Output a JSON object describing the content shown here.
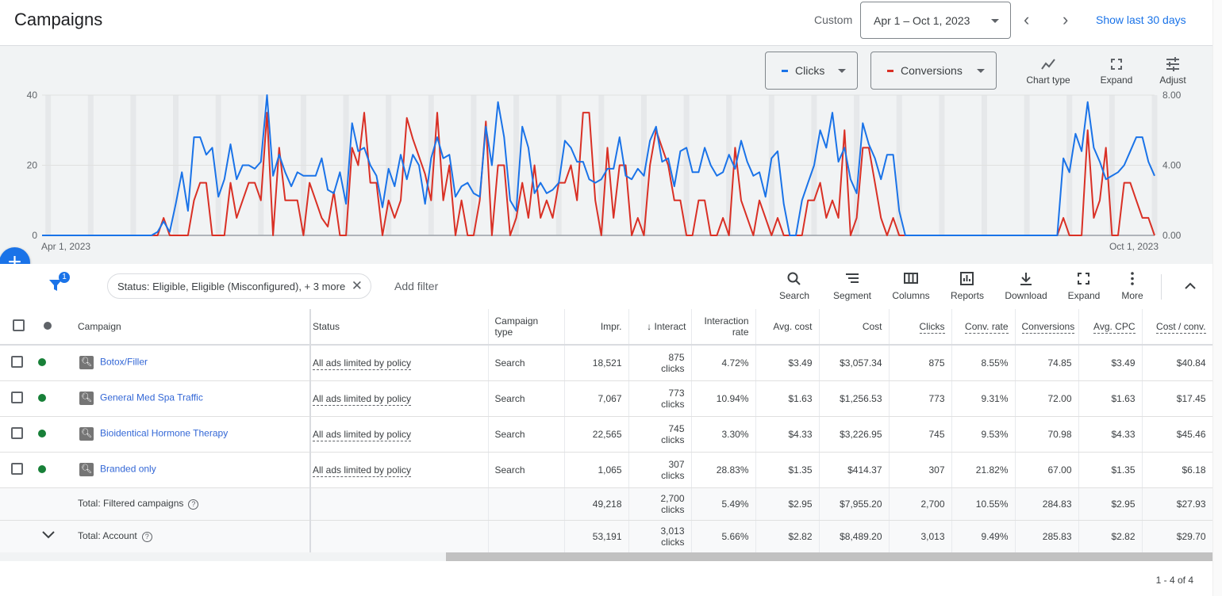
{
  "header": {
    "title": "Campaigns",
    "range_type": "Custom",
    "date_range": "Apr 1 – Oct 1, 2023",
    "show_last": "Show last 30 days"
  },
  "chart_controls": {
    "metric1": "Clicks",
    "metric2": "Conversions",
    "metric1_color": "#1a73e8",
    "metric2_color": "#d93025",
    "chart_type": "Chart type",
    "expand": "Expand",
    "adjust": "Adjust"
  },
  "chart_data": {
    "type": "line",
    "x_start": "Apr 1, 2023",
    "x_end": "Oct 1, 2023",
    "x_tick_labels": [
      "Apr 1, 2023",
      "Oct 1, 2023"
    ],
    "left_axis": {
      "ticks": [
        "0",
        "20",
        "40"
      ],
      "ylim": [
        0,
        40
      ]
    },
    "right_axis": {
      "ticks": [
        "0.00",
        "4.00",
        "8.00"
      ],
      "ylim": [
        0,
        8
      ]
    },
    "grid": true,
    "series": [
      {
        "name": "Clicks",
        "axis": "left",
        "color": "#1a73e8",
        "values": [
          0,
          0,
          0,
          0,
          0,
          0,
          0,
          0,
          0,
          0,
          0,
          0,
          0,
          0,
          0,
          0,
          0,
          0,
          0,
          1,
          4,
          1,
          9,
          18,
          7,
          28,
          28,
          23,
          25,
          11,
          16,
          26,
          16,
          20,
          20,
          19,
          21,
          40,
          17,
          23,
          18,
          14,
          18,
          17,
          17,
          17,
          22,
          13,
          12,
          18,
          9,
          32,
          24,
          25,
          20,
          17,
          8,
          19,
          14,
          23,
          16,
          23,
          20,
          9,
          22,
          28,
          22,
          23,
          11,
          14,
          15,
          12,
          11,
          31,
          20,
          38,
          28,
          10,
          7,
          31,
          25,
          12,
          15,
          12,
          13,
          15,
          27,
          25,
          21,
          21,
          16,
          15,
          16,
          19,
          19,
          28,
          17,
          16,
          19,
          17,
          27,
          31,
          21,
          22,
          14,
          24,
          25,
          18,
          18,
          25,
          20,
          17,
          18,
          23,
          19,
          27,
          21,
          17,
          18,
          11,
          22,
          24,
          9,
          0,
          0,
          10,
          15,
          20,
          30,
          25,
          35,
          21,
          25,
          16,
          12,
          32,
          26,
          22,
          16,
          23,
          23,
          7,
          0,
          0,
          0,
          0,
          0,
          0,
          0,
          0,
          0,
          0,
          0,
          0,
          0,
          0,
          0,
          0,
          0,
          0,
          0,
          0,
          0,
          0,
          0,
          0,
          0,
          0,
          22,
          18,
          29,
          24,
          38,
          25,
          21,
          16,
          17,
          18,
          20,
          24,
          28,
          28,
          21,
          17
        ]
      },
      {
        "name": "Conversions",
        "axis": "right",
        "color": "#d93025",
        "values": [
          0,
          0,
          0,
          0,
          0,
          0,
          0,
          0,
          0,
          0,
          0,
          0,
          0,
          0,
          0,
          0,
          0,
          0,
          0,
          0,
          1,
          0,
          0,
          0,
          0,
          2,
          3,
          3,
          0,
          0,
          0,
          3,
          1,
          2,
          3,
          3,
          2,
          7,
          0,
          5,
          2,
          2,
          2,
          0,
          3,
          2,
          1,
          0.5,
          2.5,
          0,
          0,
          5,
          4,
          7,
          3,
          3,
          0,
          2,
          1,
          2,
          6.7,
          5.5,
          4.5,
          3.5,
          2,
          7,
          2,
          4,
          0,
          2,
          0,
          0,
          2,
          6.5,
          0,
          4,
          4,
          0,
          1,
          3,
          1,
          4,
          1,
          2,
          1,
          3,
          3,
          4,
          2,
          7,
          7,
          2,
          0,
          5,
          1,
          4,
          4,
          0,
          1,
          0,
          4,
          6,
          5,
          4,
          2,
          2,
          0,
          0,
          2,
          2,
          0,
          0,
          1,
          0,
          5,
          2,
          1,
          0,
          2,
          1,
          0,
          1,
          0,
          0,
          0,
          0,
          2,
          2,
          3,
          1,
          2,
          1,
          6,
          0,
          1,
          5,
          5,
          3,
          1,
          0,
          1,
          0,
          0,
          0,
          0,
          0,
          0,
          0,
          0,
          0,
          0,
          0,
          0,
          0,
          0,
          0,
          0,
          0,
          0,
          0,
          0,
          0,
          0,
          0,
          0,
          0,
          0,
          0,
          1,
          0,
          0,
          0,
          6,
          1,
          2,
          5,
          0,
          0,
          3,
          3,
          2,
          1,
          1,
          0
        ]
      }
    ]
  },
  "filters": {
    "count": "1",
    "chip": "Status: Eligible, Eligible (Misconfigured), + 3 more",
    "add": "Add filter"
  },
  "toolbar": [
    "Search",
    "Segment",
    "Columns",
    "Reports",
    "Download",
    "Expand",
    "More"
  ],
  "table": {
    "columns": [
      "Campaign",
      "Status",
      "Campaign type",
      "Impr.",
      "Interact",
      "Interaction rate",
      "Avg. cost",
      "Cost",
      "Clicks",
      "Conv. rate",
      "Conversions",
      "Avg. CPC",
      "Cost / conv."
    ],
    "rows": [
      {
        "campaign": "Botox/Filler",
        "status": "All ads limited by policy",
        "type": "Search",
        "impr": "18,521",
        "inter": "875",
        "inter_unit": "clicks",
        "rate": "4.72%",
        "avg_cost": "$3.49",
        "cost": "$3,057.34",
        "clicks": "875",
        "conv_rate": "8.55%",
        "conv": "74.85",
        "cpc": "$3.49",
        "cpconv": "$40.84"
      },
      {
        "campaign": "General Med Spa Traffic",
        "status": "All ads limited by policy",
        "type": "Search",
        "impr": "7,067",
        "inter": "773",
        "inter_unit": "clicks",
        "rate": "10.94%",
        "avg_cost": "$1.63",
        "cost": "$1,256.53",
        "clicks": "773",
        "conv_rate": "9.31%",
        "conv": "72.00",
        "cpc": "$1.63",
        "cpconv": "$17.45"
      },
      {
        "campaign": "Bioidentical Hormone Therapy",
        "status": "All ads limited by policy",
        "type": "Search",
        "impr": "22,565",
        "inter": "745",
        "inter_unit": "clicks",
        "rate": "3.30%",
        "avg_cost": "$4.33",
        "cost": "$3,226.95",
        "clicks": "745",
        "conv_rate": "9.53%",
        "conv": "70.98",
        "cpc": "$4.33",
        "cpconv": "$45.46"
      },
      {
        "campaign": "Branded only",
        "status": "All ads limited by policy",
        "type": "Search",
        "impr": "1,065",
        "inter": "307",
        "inter_unit": "clicks",
        "rate": "28.83%",
        "avg_cost": "$1.35",
        "cost": "$414.37",
        "clicks": "307",
        "conv_rate": "21.82%",
        "conv": "67.00",
        "cpc": "$1.35",
        "cpconv": "$6.18"
      }
    ],
    "totals": [
      {
        "label": "Total: Filtered campaigns",
        "impr": "49,218",
        "inter": "2,700",
        "inter_unit": "clicks",
        "rate": "5.49%",
        "avg_cost": "$2.95",
        "cost": "$7,955.20",
        "clicks": "2,700",
        "conv_rate": "10.55%",
        "conv": "284.83",
        "cpc": "$2.95",
        "cpconv": "$27.93"
      },
      {
        "label": "Total: Account",
        "impr": "53,191",
        "inter": "3,013",
        "inter_unit": "clicks",
        "rate": "5.66%",
        "avg_cost": "$2.82",
        "cost": "$8,489.20",
        "clicks": "3,013",
        "conv_rate": "9.49%",
        "conv": "285.83",
        "cpc": "$2.82",
        "cpconv": "$29.70"
      }
    ]
  },
  "pager": "1 - 4 of 4"
}
